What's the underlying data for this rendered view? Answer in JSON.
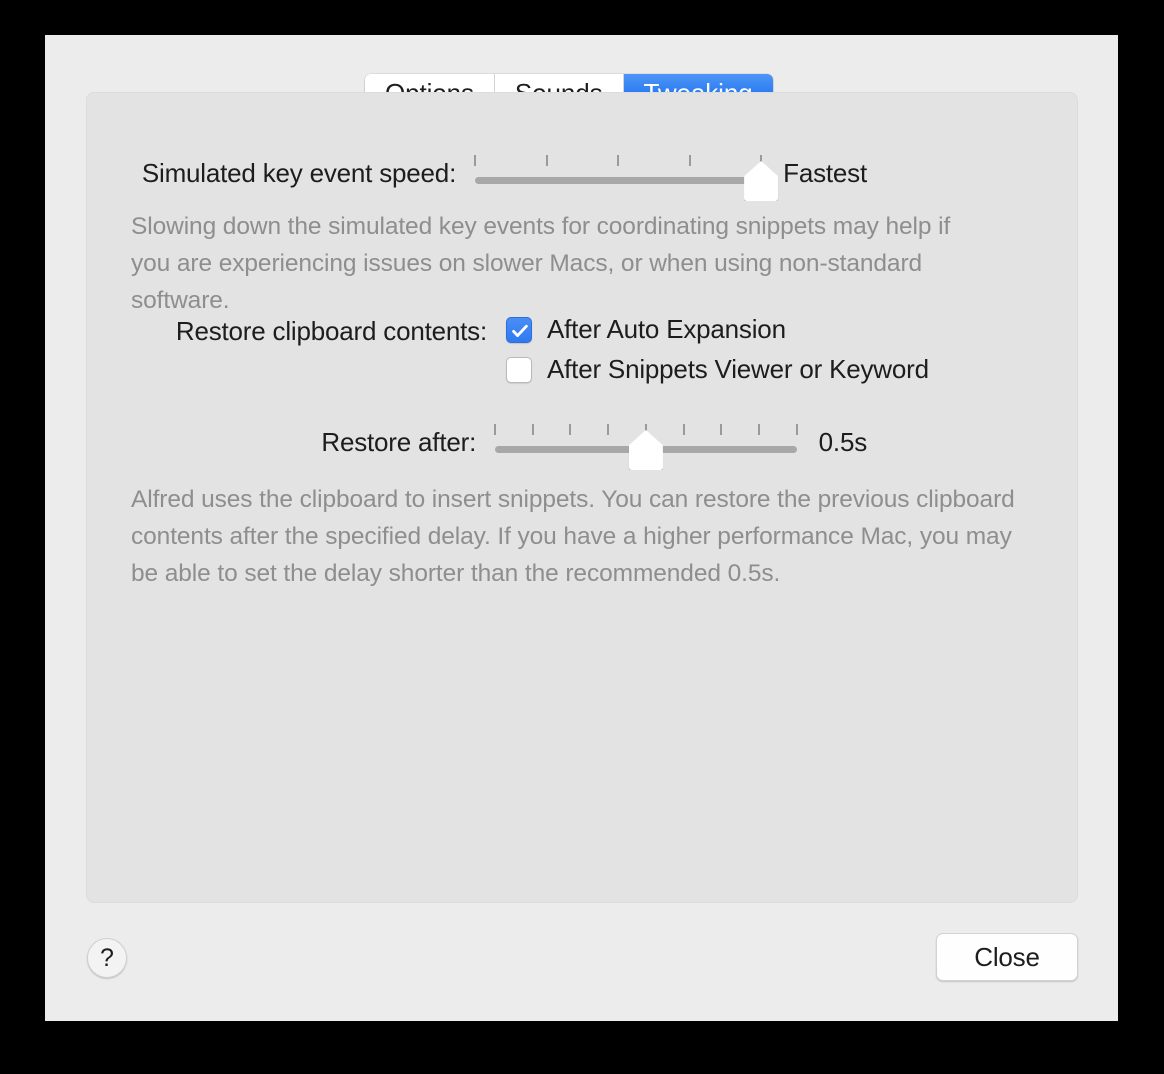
{
  "window": {
    "background_color": "#ECECEC",
    "panel_background_color": "#E3E3E3"
  },
  "tabs": [
    {
      "label": "Options",
      "selected": false
    },
    {
      "label": "Sounds",
      "selected": false
    },
    {
      "label": "Tweaking",
      "selected": true
    }
  ],
  "accent_color": "#2F7AF2",
  "key_speed": {
    "label": "Simulated key event speed:",
    "value_label": "Fastest",
    "tick_count": 5,
    "thumb_percent": 100,
    "help_text": "Slowing down the simulated key events for coordinating snippets may help if you are experiencing issues on slower Macs, or when using non-standard software."
  },
  "restore_clipboard": {
    "label": "Restore clipboard contents:",
    "options": [
      {
        "label": "After Auto Expansion",
        "checked": true
      },
      {
        "label": "After Snippets Viewer or Keyword",
        "checked": false
      }
    ]
  },
  "restore_after": {
    "label": "Restore after:",
    "value_label": "0.5s",
    "tick_count": 9,
    "thumb_percent": 50,
    "help_text": "Alfred uses the clipboard to insert snippets. You can restore the previous clipboard contents after the specified delay. If you have a higher performance Mac, you may be able to set the delay shorter than the recommended 0.5s."
  },
  "footer": {
    "help_label": "?",
    "close_label": "Close"
  }
}
